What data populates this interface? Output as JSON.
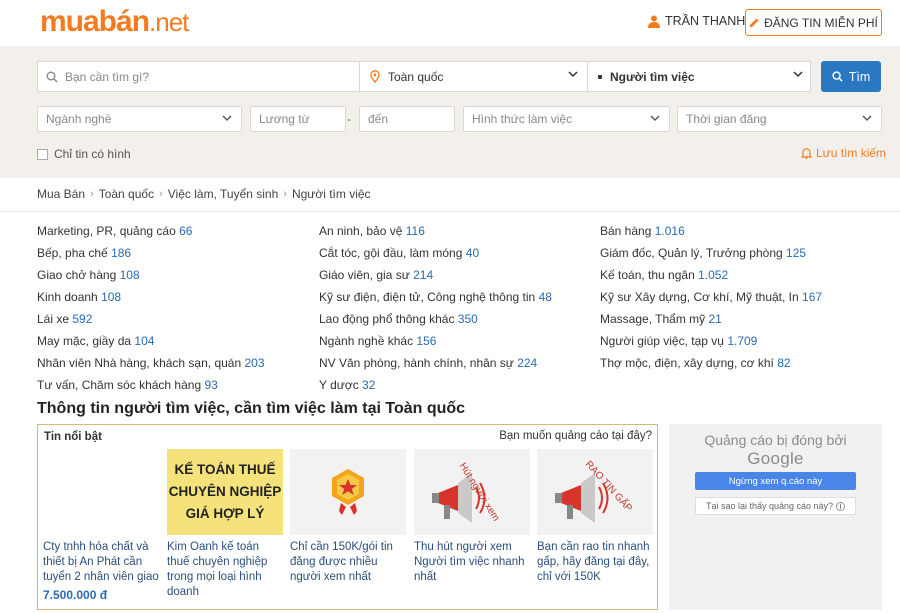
{
  "header": {
    "logo_main": "muabán",
    "logo_tld": ".net",
    "user_name": "TRẦN THANH",
    "post_button": "ĐĂNG TIN MIỄN PHÍ"
  },
  "search": {
    "keyword_placeholder": "Bạn cần tìm gì?",
    "location_value": "Toàn quốc",
    "category_value": "Người tìm việc",
    "search_button": "Tìm",
    "industry_placeholder": "Ngành nghề",
    "salary_from_placeholder": "Lương từ",
    "salary_dash": "-",
    "salary_to_placeholder": "đến",
    "work_type_placeholder": "Hình thức làm việc",
    "post_time_placeholder": "Thời gian đăng",
    "only_with_images": "Chỉ tin có hình",
    "save_search": "Lưu tìm kiếm"
  },
  "breadcrumb": [
    "Mua Bán",
    "Toàn quốc",
    "Việc làm, Tuyển sinh",
    "Người tìm việc"
  ],
  "categories": [
    [
      {
        "name": "Marketing, PR, quảng cáo",
        "count": "66"
      },
      {
        "name": "Bếp, pha chế",
        "count": "186"
      },
      {
        "name": "Giao chở hàng",
        "count": "108"
      },
      {
        "name": "Kinh doanh",
        "count": "108"
      },
      {
        "name": "Lái xe",
        "count": "592"
      },
      {
        "name": "May mặc, giầy da",
        "count": "104"
      },
      {
        "name": "Nhân viên Nhà hàng, khách sạn, quán",
        "count": "203"
      },
      {
        "name": "Tư vấn, Chăm sóc khách hàng",
        "count": "93"
      }
    ],
    [
      {
        "name": "An ninh, bảo vệ",
        "count": "116"
      },
      {
        "name": "Cắt tóc, gội đầu, làm móng",
        "count": "40"
      },
      {
        "name": "Giáo viên, gia sư",
        "count": "214"
      },
      {
        "name": "Kỹ sư điện, điện tử, Công nghệ thông tin",
        "count": "48"
      },
      {
        "name": "Lao động phổ thông khác",
        "count": "350"
      },
      {
        "name": "Ngành nghề khác",
        "count": "156"
      },
      {
        "name": "NV Văn phòng, hành chính, nhân sự",
        "count": "224"
      },
      {
        "name": "Y dược",
        "count": "32"
      }
    ],
    [
      {
        "name": "Bán hàng",
        "count": "1.016"
      },
      {
        "name": "Giám đốc, Quản lý, Trưởng phòng",
        "count": "125"
      },
      {
        "name": "Kế toán, thu ngân",
        "count": "1.052"
      },
      {
        "name": "Kỹ sư Xây dựng, Cơ khí, Mỹ thuật, In",
        "count": "167"
      },
      {
        "name": "Massage, Thẩm mỹ",
        "count": "21"
      },
      {
        "name": "Người giúp việc, tạp vụ",
        "count": "1.709"
      },
      {
        "name": "Thợ mộc, điện, xây dựng, cơ khí",
        "count": "82"
      }
    ]
  ],
  "section_title": "Thông tin người tìm việc, cần tìm việc làm tại Toàn quốc",
  "featured": {
    "label": "Tin nổi bật",
    "ad_question": "Bạn muốn quảng cáo tại đây?",
    "cards": [
      {
        "title": "Cty tnhh hóa chất và thiết bị An Phát cần tuyển 2 nhân viên giao",
        "price": "7.500.000 đ"
      },
      {
        "title": "Kim Oanh kế toán thuế chuyên nghiệp trong mọi loại hình doanh",
        "thumb_lines": [
          "KẾ TOÁN THUẾ",
          "CHUYÊN NGHIỆP",
          "GIÁ HỢP LÝ"
        ]
      },
      {
        "title": "Chỉ cần 150K/gói tin đăng được nhiều người xem nhất"
      },
      {
        "title": "Thu hút người xem Người tìm việc nhanh nhất",
        "thumb_text": "Hút người xem"
      },
      {
        "title": "Bạn cần rao tin nhanh gấp, hãy đăng tại đây, chỉ với 150K",
        "thumb_text": "RAO TIN GẤP"
      }
    ]
  },
  "ad_panel": {
    "stopped_text": "Quảng cáo bị đóng bởi",
    "brand": "Google",
    "stop_button": "Ngừng xem q.cáo này",
    "why_button": "Tại sao lại thấy quảng cáo này?"
  },
  "colors": {
    "brand_orange": "#f47b20",
    "search_blue": "#2a78c2",
    "count_blue": "#2a6ab0"
  }
}
